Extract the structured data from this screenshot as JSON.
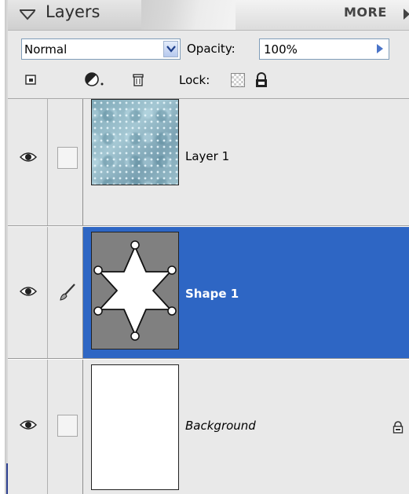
{
  "header": {
    "title": "Layers",
    "more_label": "MORE"
  },
  "options": {
    "blend_mode": "Normal",
    "opacity_label": "Opacity:",
    "opacity_value": "100%",
    "lock_label": "Lock:"
  },
  "icons": {
    "new_layer": "new-layer-icon",
    "adjustment": "adjustment-layer-icon",
    "delete": "trash-icon",
    "lock_transparent": "lock-transparency-icon",
    "lock_all": "lock-icon",
    "visibility": "eye-icon",
    "brush": "brush-icon"
  },
  "colors": {
    "selected_row": "#2e66c4",
    "panel_bg": "#e9e9e9",
    "shape_thumb_bg": "#808080"
  },
  "layers": [
    {
      "name": "Layer 1",
      "visible": true,
      "selected": false,
      "italic": false,
      "locked": false
    },
    {
      "name": "Shape 1",
      "visible": true,
      "selected": true,
      "italic": false,
      "locked": false
    },
    {
      "name": "Background",
      "visible": true,
      "selected": false,
      "italic": true,
      "locked": true
    }
  ]
}
